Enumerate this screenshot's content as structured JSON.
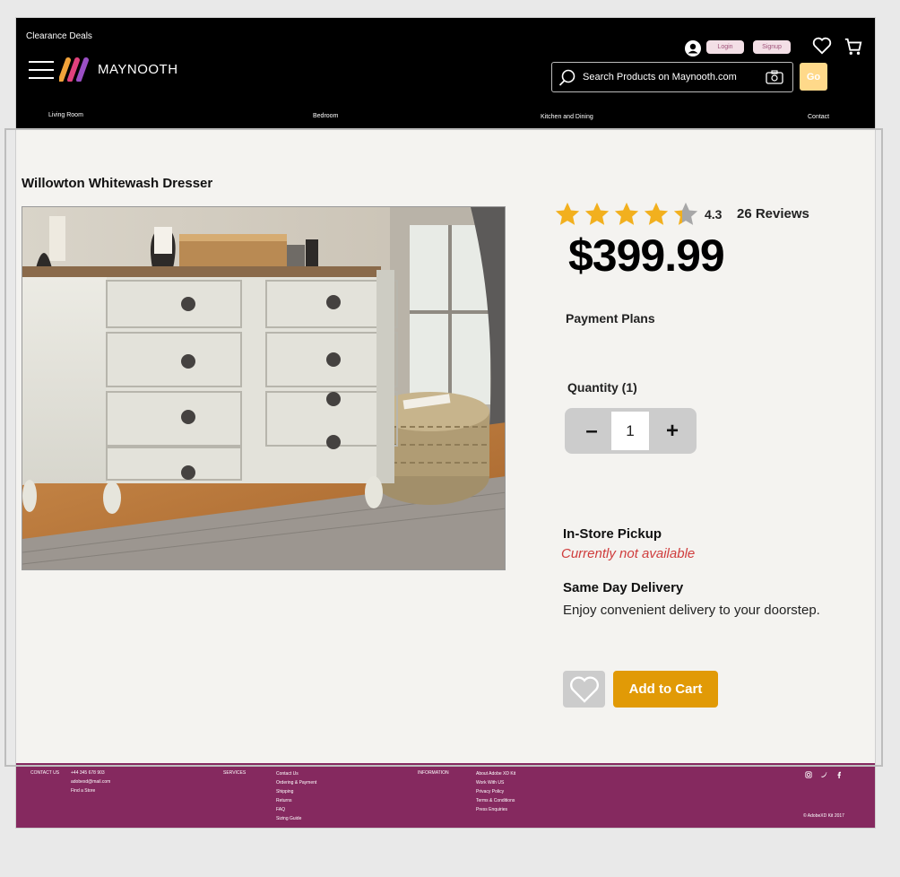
{
  "header": {
    "clearance": "Clearance Deals",
    "brand": "MAYNOOTH",
    "login": "Login",
    "signup": "Signup",
    "search_placeholder": "Search Products on Maynooth.com",
    "go": "Go",
    "nav": [
      "Living Room",
      "Bedroom",
      "Kitchen and Dining",
      "Contact"
    ]
  },
  "product": {
    "title": "Willowton Whitewash Dresser",
    "rating": "4.3",
    "rating_value": 4.3,
    "reviews": "26 Reviews",
    "price": "$399.99",
    "payment_plans": "Payment Plans",
    "quantity_label": "Quantity (1)",
    "quantity": "1",
    "minus": "–",
    "plus": "+",
    "pickup_title": "In-Store Pickup",
    "pickup_status": "Currently not available",
    "delivery_title": "Same Day Delivery",
    "delivery_text": "Enjoy convenient delivery to your doorstep.",
    "add_to_cart": "Add to Cart"
  },
  "footer": {
    "contact_us": "CONTACT US",
    "phone": "+44 345 678 903",
    "email": "adobexd@mail.com",
    "find_store": "Find a Store",
    "services": "SERVICES",
    "services_links": [
      "Contact Us",
      "Ordering & Payment",
      "Shipping",
      "Returns",
      "FAQ",
      "Sizing Guide"
    ],
    "information": "INFORMATION",
    "info_links": [
      "About Adobe XD Kit",
      "Work With US",
      "Privacy Policy",
      "Terms & Conditions",
      "Press Enquiries"
    ],
    "copyright": "© AdobeXD Kit 2017"
  },
  "colors": {
    "header_bg": "#000000",
    "accent": "#e19a06",
    "footer_bg": "#85295f",
    "star": "#f2b01e",
    "alert": "#cf3c3c"
  }
}
